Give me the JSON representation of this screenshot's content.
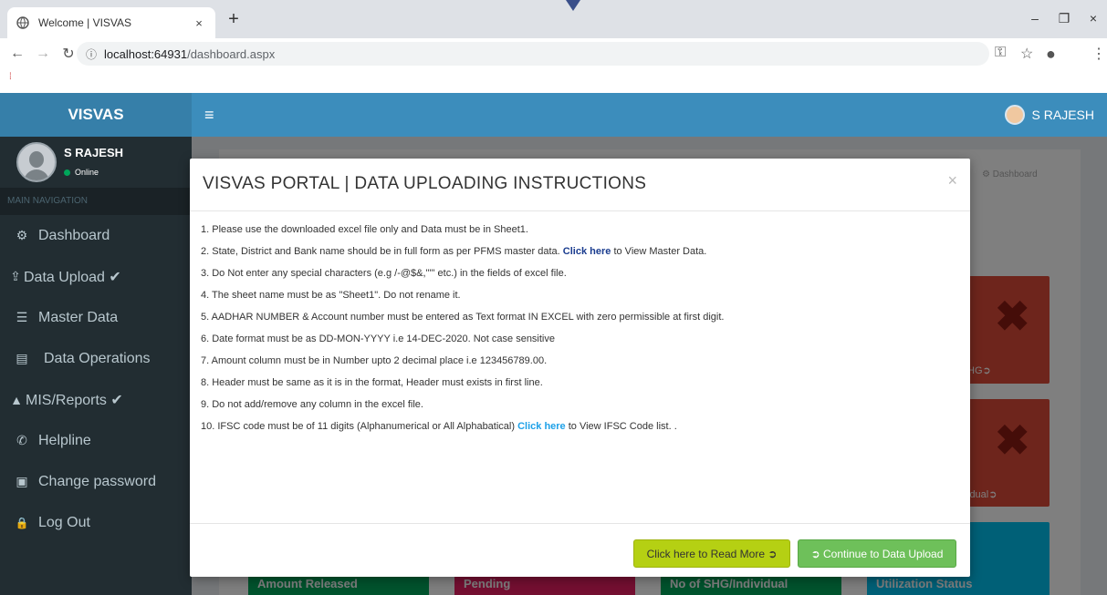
{
  "browser": {
    "tab_title": "Welcome | VISVAS",
    "tab_close": "×",
    "new_tab": "+",
    "url_host": "localhost:64931",
    "url_path": "/dashboard.aspx",
    "minimize": "–",
    "maximize": "❐",
    "close": "×"
  },
  "app": {
    "brand": "VISVAS",
    "hamburger": "≡",
    "user_name": "S RAJESH"
  },
  "sidebar": {
    "user_name": "S RAJESH",
    "status": "Online",
    "nav_header": "MAIN NAVIGATION",
    "items": [
      {
        "label": "Dashboard",
        "icon": "dashboard-icon",
        "glyph": "⚙"
      },
      {
        "label": "Data Upload ✔",
        "icon": "upload-icon",
        "glyph": "⇪"
      },
      {
        "label": "Master Data",
        "icon": "database-icon",
        "glyph": "☰"
      },
      {
        "label": "Data Operations",
        "icon": "file-icon",
        "glyph": "▤"
      },
      {
        "label": "MIS/Reports ✔",
        "icon": "chart-icon",
        "glyph": "▲"
      },
      {
        "label": "Helpline",
        "icon": "phone-icon",
        "glyph": "✆"
      },
      {
        "label": "Change password",
        "icon": "id-card-icon",
        "glyph": "▣"
      },
      {
        "label": "Log Out",
        "icon": "lock-icon",
        "glyph": "🔒"
      }
    ]
  },
  "content": {
    "breadcrumb": "Dashboard",
    "card1_label": "HG➲",
    "card2_label": "idual➲",
    "tiles": [
      "Amount Released",
      "Pending",
      "No of SHG/Individual",
      "Utilization Status"
    ]
  },
  "modal": {
    "title": "VISVAS PORTAL | DATA UPLOADING INSTRUCTIONS",
    "close": "×",
    "instructions": {
      "i1": "1. Please use the downloaded excel file only and Data must be in Sheet1.",
      "i2_pre": "2. State, District and Bank name should be in full form as per PFMS master data.",
      "i2_link": "Click here",
      "i2_post": " to View Master Data.",
      "i3": "3. Do Not enter any special characters (e.g /-@$&,'\"\" etc.) in the fields of excel file.",
      "i4": "4. The sheet name must be as \"Sheet1\". Do not rename it.",
      "i5": "5. AADHAR NUMBER & Account number must be entered as Text format IN EXCEL with zero permissible at first digit.",
      "i6": "6. Date format must be as DD-MON-YYYY i.e 14-DEC-2020. Not case sensitive",
      "i7": "7. Amount column must be in Number upto 2 decimal place i.e 123456789.00.",
      "i8": "8. Header must be same as it is in the format, Header must exists in first line.",
      "i9": "9. Do not add/remove any column in the excel file.",
      "i10_pre": "10. IFSC code must be of 11 digits (Alphanumerical or All Alphabatical) ",
      "i10_link": "Click here",
      "i10_post": " to View IFSC Code list. ."
    },
    "read_more": "Click here to Read More ➲",
    "continue": "➲ Continue to Data Upload"
  }
}
